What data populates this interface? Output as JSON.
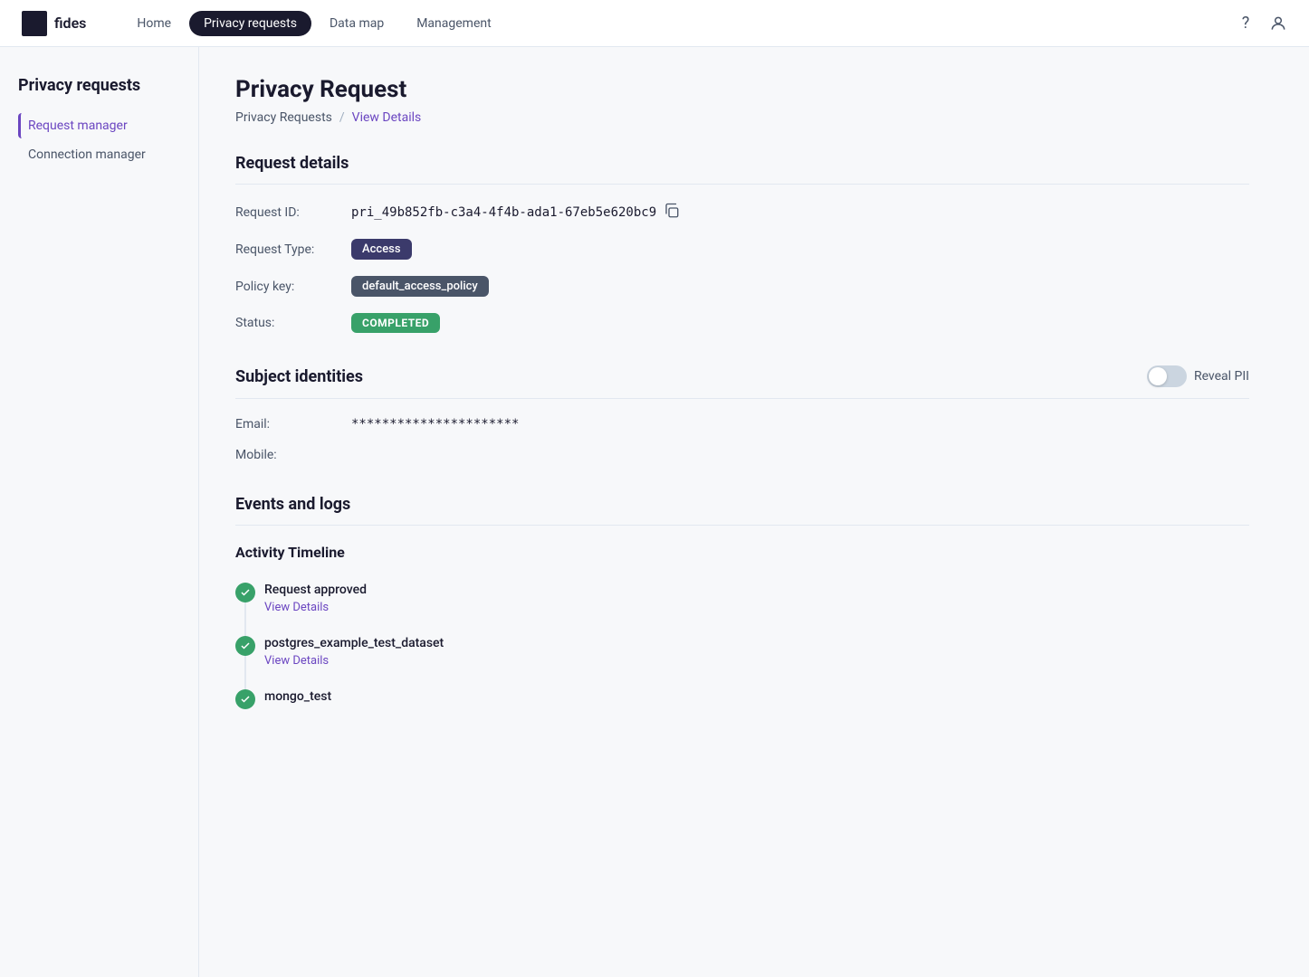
{
  "nav": {
    "logo_text": "fides",
    "links": [
      {
        "label": "Home",
        "active": false
      },
      {
        "label": "Privacy requests",
        "active": true
      },
      {
        "label": "Data map",
        "active": false
      },
      {
        "label": "Management",
        "active": false
      }
    ]
  },
  "sidebar": {
    "title": "Privacy requests",
    "items": [
      {
        "label": "Request manager",
        "active": true
      },
      {
        "label": "Connection manager",
        "active": false
      }
    ]
  },
  "page": {
    "title": "Privacy Request",
    "breadcrumb_root": "Privacy Requests",
    "breadcrumb_current": "View Details"
  },
  "request_details": {
    "section_title": "Request details",
    "request_id_label": "Request ID:",
    "request_id_value": "pri_49b852fb-c3a4-4f4b-ada1-67eb5e620bc9",
    "request_type_label": "Request Type:",
    "request_type_value": "Access",
    "policy_key_label": "Policy key:",
    "policy_key_value": "default_access_policy",
    "status_label": "Status:",
    "status_value": "COMPLETED"
  },
  "subject_identities": {
    "section_title": "Subject identities",
    "reveal_pii_label": "Reveal PII",
    "email_label": "Email:",
    "email_value": "**********************",
    "mobile_label": "Mobile:"
  },
  "events_logs": {
    "section_title": "Events and logs",
    "timeline_title": "Activity Timeline",
    "timeline_items": [
      {
        "label": "Request approved",
        "link": "View Details"
      },
      {
        "label": "postgres_example_test_dataset",
        "link": "View Details"
      },
      {
        "label": "mongo_test",
        "link": ""
      }
    ]
  },
  "icons": {
    "help": "?",
    "user": "👤",
    "copy": "⧉",
    "check": "✓"
  }
}
